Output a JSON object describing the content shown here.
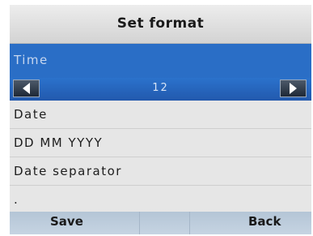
{
  "header": {
    "title": "Set format"
  },
  "selected_setting": {
    "label": "Time",
    "value": "12",
    "prev_icon": "arrow-left-icon",
    "next_icon": "arrow-right-icon"
  },
  "list": {
    "items": [
      {
        "label": "Date"
      },
      {
        "label": "DD MM YYYY"
      },
      {
        "label": "Date separator"
      },
      {
        "label": "."
      }
    ]
  },
  "softkeys": {
    "left": "Save",
    "right": "Back"
  },
  "colors": {
    "selection": "#2a6ec6",
    "background": "#e6e6e6",
    "softkey_bar": "#bccbdc"
  }
}
